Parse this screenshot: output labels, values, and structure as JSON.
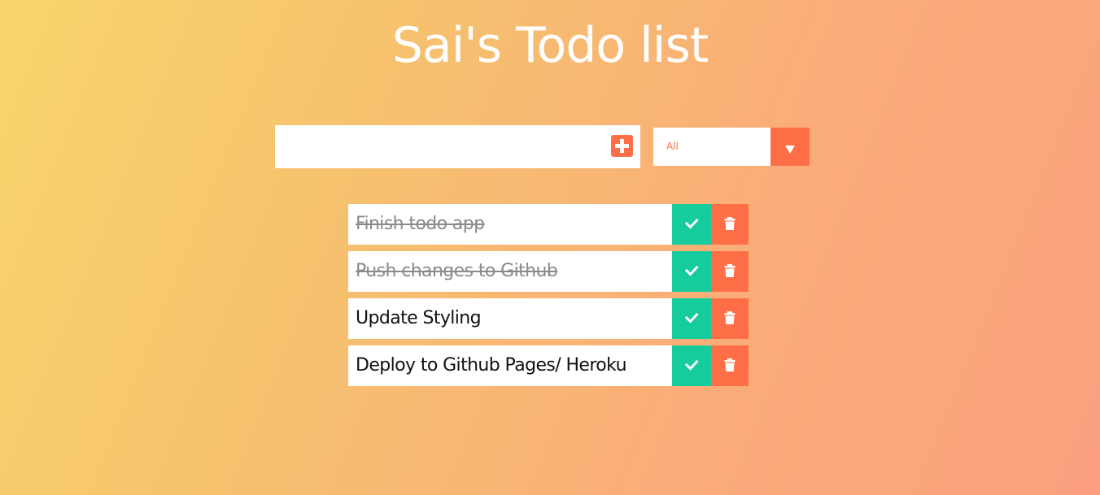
{
  "header": {
    "title": "Sai's Todo list"
  },
  "form": {
    "input_value": "",
    "add_icon": "plus-square-icon",
    "filter_selected": "All",
    "filter_icon": "caret-down-icon"
  },
  "todos": [
    {
      "text": "Finish todo app",
      "completed": true
    },
    {
      "text": "Push changes to Github",
      "completed": true
    },
    {
      "text": "Update Styling",
      "completed": false
    },
    {
      "text": "Deploy to Github Pages/ Heroku",
      "completed": false
    }
  ],
  "icons": {
    "complete": "check-icon",
    "delete": "trash-icon"
  },
  "colors": {
    "accent": "#ff6f47",
    "complete": "#17cc9c",
    "title": "#ffffff"
  }
}
